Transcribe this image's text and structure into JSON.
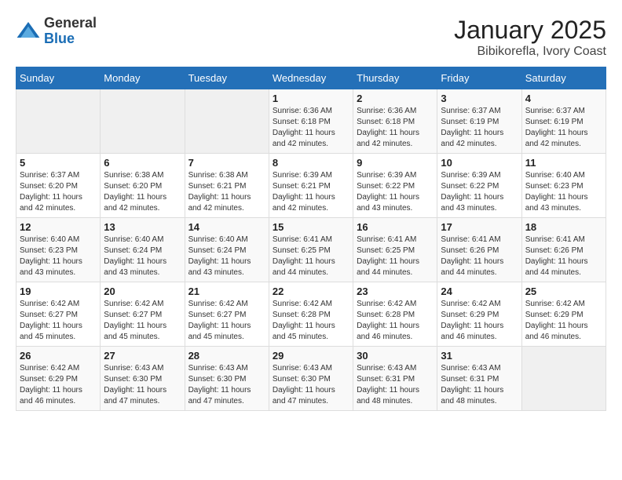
{
  "logo": {
    "general": "General",
    "blue": "Blue"
  },
  "title": "January 2025",
  "subtitle": "Bibikorefla, Ivory Coast",
  "weekdays": [
    "Sunday",
    "Monday",
    "Tuesday",
    "Wednesday",
    "Thursday",
    "Friday",
    "Saturday"
  ],
  "weeks": [
    [
      {
        "day": "",
        "info": ""
      },
      {
        "day": "",
        "info": ""
      },
      {
        "day": "",
        "info": ""
      },
      {
        "day": "1",
        "info": "Sunrise: 6:36 AM\nSunset: 6:18 PM\nDaylight: 11 hours\nand 42 minutes."
      },
      {
        "day": "2",
        "info": "Sunrise: 6:36 AM\nSunset: 6:18 PM\nDaylight: 11 hours\nand 42 minutes."
      },
      {
        "day": "3",
        "info": "Sunrise: 6:37 AM\nSunset: 6:19 PM\nDaylight: 11 hours\nand 42 minutes."
      },
      {
        "day": "4",
        "info": "Sunrise: 6:37 AM\nSunset: 6:19 PM\nDaylight: 11 hours\nand 42 minutes."
      }
    ],
    [
      {
        "day": "5",
        "info": "Sunrise: 6:37 AM\nSunset: 6:20 PM\nDaylight: 11 hours\nand 42 minutes."
      },
      {
        "day": "6",
        "info": "Sunrise: 6:38 AM\nSunset: 6:20 PM\nDaylight: 11 hours\nand 42 minutes."
      },
      {
        "day": "7",
        "info": "Sunrise: 6:38 AM\nSunset: 6:21 PM\nDaylight: 11 hours\nand 42 minutes."
      },
      {
        "day": "8",
        "info": "Sunrise: 6:39 AM\nSunset: 6:21 PM\nDaylight: 11 hours\nand 42 minutes."
      },
      {
        "day": "9",
        "info": "Sunrise: 6:39 AM\nSunset: 6:22 PM\nDaylight: 11 hours\nand 43 minutes."
      },
      {
        "day": "10",
        "info": "Sunrise: 6:39 AM\nSunset: 6:22 PM\nDaylight: 11 hours\nand 43 minutes."
      },
      {
        "day": "11",
        "info": "Sunrise: 6:40 AM\nSunset: 6:23 PM\nDaylight: 11 hours\nand 43 minutes."
      }
    ],
    [
      {
        "day": "12",
        "info": "Sunrise: 6:40 AM\nSunset: 6:23 PM\nDaylight: 11 hours\nand 43 minutes."
      },
      {
        "day": "13",
        "info": "Sunrise: 6:40 AM\nSunset: 6:24 PM\nDaylight: 11 hours\nand 43 minutes."
      },
      {
        "day": "14",
        "info": "Sunrise: 6:40 AM\nSunset: 6:24 PM\nDaylight: 11 hours\nand 43 minutes."
      },
      {
        "day": "15",
        "info": "Sunrise: 6:41 AM\nSunset: 6:25 PM\nDaylight: 11 hours\nand 44 minutes."
      },
      {
        "day": "16",
        "info": "Sunrise: 6:41 AM\nSunset: 6:25 PM\nDaylight: 11 hours\nand 44 minutes."
      },
      {
        "day": "17",
        "info": "Sunrise: 6:41 AM\nSunset: 6:26 PM\nDaylight: 11 hours\nand 44 minutes."
      },
      {
        "day": "18",
        "info": "Sunrise: 6:41 AM\nSunset: 6:26 PM\nDaylight: 11 hours\nand 44 minutes."
      }
    ],
    [
      {
        "day": "19",
        "info": "Sunrise: 6:42 AM\nSunset: 6:27 PM\nDaylight: 11 hours\nand 45 minutes."
      },
      {
        "day": "20",
        "info": "Sunrise: 6:42 AM\nSunset: 6:27 PM\nDaylight: 11 hours\nand 45 minutes."
      },
      {
        "day": "21",
        "info": "Sunrise: 6:42 AM\nSunset: 6:27 PM\nDaylight: 11 hours\nand 45 minutes."
      },
      {
        "day": "22",
        "info": "Sunrise: 6:42 AM\nSunset: 6:28 PM\nDaylight: 11 hours\nand 45 minutes."
      },
      {
        "day": "23",
        "info": "Sunrise: 6:42 AM\nSunset: 6:28 PM\nDaylight: 11 hours\nand 46 minutes."
      },
      {
        "day": "24",
        "info": "Sunrise: 6:42 AM\nSunset: 6:29 PM\nDaylight: 11 hours\nand 46 minutes."
      },
      {
        "day": "25",
        "info": "Sunrise: 6:42 AM\nSunset: 6:29 PM\nDaylight: 11 hours\nand 46 minutes."
      }
    ],
    [
      {
        "day": "26",
        "info": "Sunrise: 6:42 AM\nSunset: 6:29 PM\nDaylight: 11 hours\nand 46 minutes."
      },
      {
        "day": "27",
        "info": "Sunrise: 6:43 AM\nSunset: 6:30 PM\nDaylight: 11 hours\nand 47 minutes."
      },
      {
        "day": "28",
        "info": "Sunrise: 6:43 AM\nSunset: 6:30 PM\nDaylight: 11 hours\nand 47 minutes."
      },
      {
        "day": "29",
        "info": "Sunrise: 6:43 AM\nSunset: 6:30 PM\nDaylight: 11 hours\nand 47 minutes."
      },
      {
        "day": "30",
        "info": "Sunrise: 6:43 AM\nSunset: 6:31 PM\nDaylight: 11 hours\nand 48 minutes."
      },
      {
        "day": "31",
        "info": "Sunrise: 6:43 AM\nSunset: 6:31 PM\nDaylight: 11 hours\nand 48 minutes."
      },
      {
        "day": "",
        "info": ""
      }
    ]
  ]
}
